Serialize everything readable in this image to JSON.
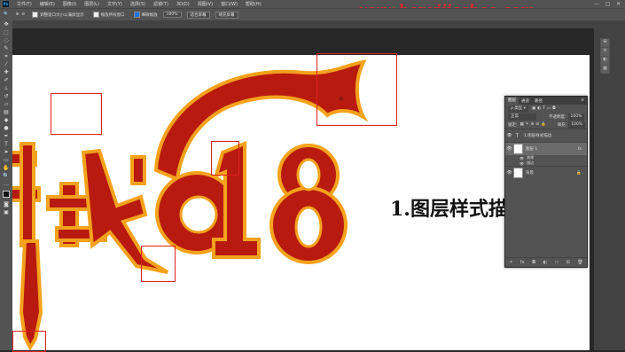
{
  "menubar": {
    "items": [
      "文件(F)",
      "编辑(E)",
      "图像(I)",
      "图层(L)",
      "文字(Y)",
      "选择(S)",
      "滤镜(T)",
      "3D(D)",
      "视图(V)",
      "窗口(W)",
      "帮助(H)"
    ]
  },
  "watermark": "www.hanyijieshao.com",
  "options": {
    "resize": "调整窗口大小以满屏显示",
    "zoom_all": "缩放所有窗口",
    "scrubby": "细微缩放",
    "zoom_value": "100%",
    "fit_screen": "适合屏幕",
    "fill_screen": "填充屏幕"
  },
  "layers_panel": {
    "tabs": [
      "图层",
      "通道",
      "路径"
    ],
    "kind": "类型",
    "blend_mode": "正常",
    "opacity_label": "不透明度:",
    "opacity_value": "100%",
    "lock_label": "锁定:",
    "fill_label": "填充:",
    "fill_value": "100%",
    "layers": [
      {
        "name": "1.图层样式描边",
        "type": "text",
        "thumb": "T"
      },
      {
        "name": "图层 1",
        "type": "pixel",
        "thumb": "",
        "fx": "fx"
      },
      {
        "name": "背景",
        "type": "background",
        "thumb": ""
      }
    ],
    "effects_label": "效果",
    "stroke_label": "描边"
  },
  "canvas": {
    "big_number": "618",
    "chars": "印战",
    "caption": "1.图层样式描"
  },
  "colors": {
    "fill_red": "#b81a0f",
    "stroke_orange": "#f4a21c",
    "annotation_red": "#e02020"
  }
}
